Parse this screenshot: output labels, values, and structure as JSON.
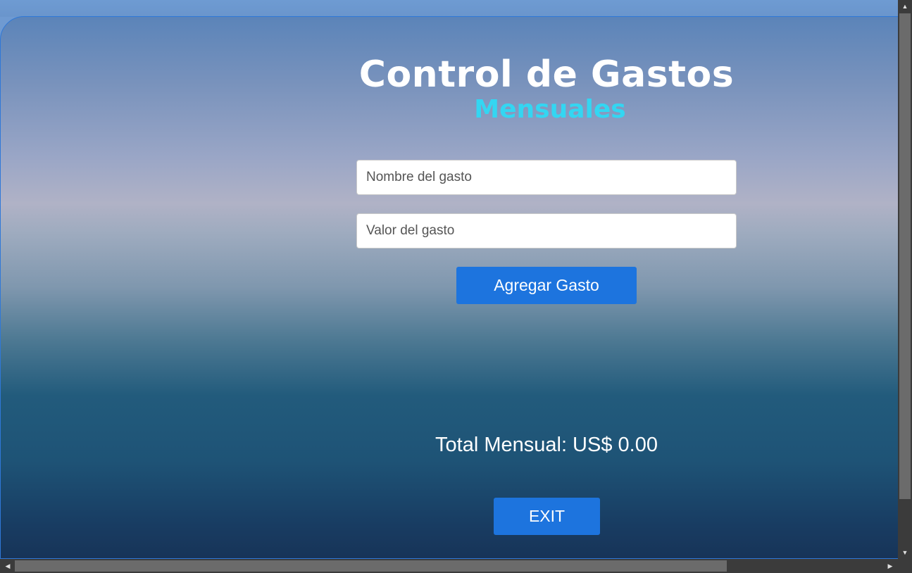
{
  "app": {
    "title": "Control de Gastos",
    "subtitle": "Mensuales"
  },
  "form": {
    "name_placeholder": "Nombre del gasto",
    "value_placeholder": "Valor del gasto",
    "add_button_label": "Agregar Gasto"
  },
  "summary": {
    "total_text": "Total Mensual: US$ 0.00"
  },
  "actions": {
    "exit_label": "EXIT"
  },
  "icons": {
    "scroll_up": "triangle-up-icon",
    "scroll_down": "triangle-down-icon",
    "scroll_left": "triangle-left-icon",
    "scroll_right": "triangle-right-icon"
  },
  "colors": {
    "accent": "#1d74de",
    "subtitle": "#33d6f2",
    "title": "#ffffff"
  }
}
